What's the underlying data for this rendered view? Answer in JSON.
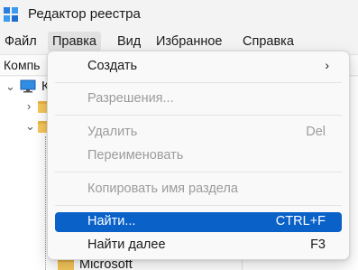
{
  "window": {
    "title": "Редактор реестра"
  },
  "menubar": {
    "items": [
      {
        "label": "Файл",
        "active": false
      },
      {
        "label": "Правка",
        "active": true
      },
      {
        "label": "Вид",
        "active": false
      },
      {
        "label": "Избранное",
        "active": false
      },
      {
        "label": "Справка",
        "active": false
      }
    ]
  },
  "address": {
    "text": "Компь"
  },
  "tree": {
    "root_label": "К",
    "visible_label": "Microsoft"
  },
  "context_menu": {
    "items": [
      {
        "label": "Создать",
        "shortcut": "",
        "submenu_arrow": "›",
        "disabled": false,
        "highlighted": false
      },
      {
        "label": "Разрешения...",
        "shortcut": "",
        "disabled": true,
        "highlighted": false
      },
      {
        "label": "Удалить",
        "shortcut": "Del",
        "disabled": true,
        "highlighted": false
      },
      {
        "label": "Переименовать",
        "shortcut": "",
        "disabled": true,
        "highlighted": false
      },
      {
        "label": "Копировать имя раздела",
        "shortcut": "",
        "disabled": true,
        "highlighted": false
      },
      {
        "label": "Найти...",
        "shortcut": "CTRL+F",
        "disabled": false,
        "highlighted": true
      },
      {
        "label": "Найти далее",
        "shortcut": "F3",
        "disabled": false,
        "highlighted": false
      }
    ]
  },
  "colors": {
    "highlight": "#0a62c9",
    "disabled_text": "#9c9c9c",
    "folder": "#f5c65a"
  }
}
